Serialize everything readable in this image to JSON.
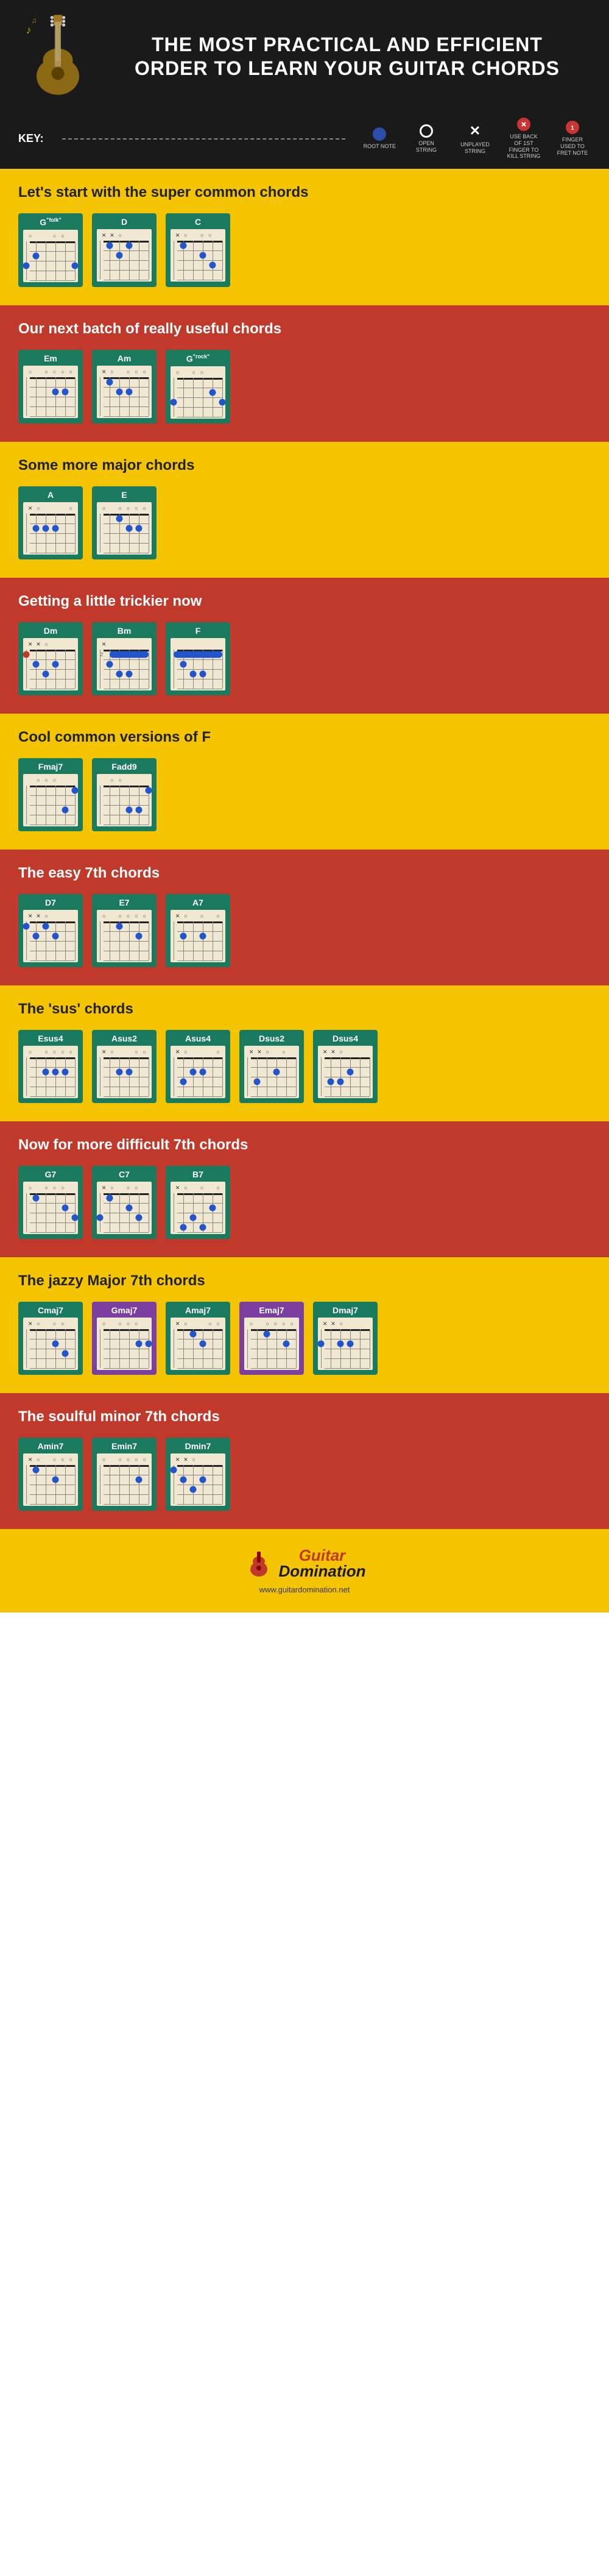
{
  "header": {
    "title": "THE MOST PRACTICAL AND EFFICIENT ORDER TO LEARN YOUR GUITAR CHORDS",
    "key_label": "KEY:"
  },
  "key_items": [
    {
      "label": "ROOT NOTE",
      "type": "root"
    },
    {
      "label": "OPEN STRING",
      "type": "open"
    },
    {
      "label": "UNPLAYED STRING",
      "type": "unplayed"
    },
    {
      "label": "USE BACK OF 1ST FINGER TO KILL STRING",
      "type": "back"
    },
    {
      "label": "FINGER USED TO FRET NOTE",
      "type": "fret"
    }
  ],
  "sections": [
    {
      "id": "super-common",
      "bg": "yellow",
      "title": "Let's start with the super common chords",
      "chords": [
        "G\"folk\"",
        "D",
        "C"
      ]
    },
    {
      "id": "useful",
      "bg": "red",
      "title": "Our next batch of really useful chords",
      "chords": [
        "Em",
        "Am",
        "G\"rock\""
      ]
    },
    {
      "id": "major",
      "bg": "yellow",
      "title": "Some more major chords",
      "chords": [
        "A",
        "E"
      ]
    },
    {
      "id": "tricky",
      "bg": "red",
      "title": "Getting a little trickier now",
      "chords": [
        "Dm",
        "Bm",
        "F"
      ]
    },
    {
      "id": "f-versions",
      "bg": "yellow",
      "title": "Cool common versions of F",
      "chords": [
        "Fmaj7",
        "Fadd9"
      ]
    },
    {
      "id": "easy-7th",
      "bg": "red",
      "title": "The easy 7th chords",
      "chords": [
        "D7",
        "E7",
        "A7"
      ]
    },
    {
      "id": "sus",
      "bg": "yellow",
      "title": "The 'sus' chords",
      "chords": [
        "Esus4",
        "Asus2",
        "Asus4",
        "Dsus2",
        "Dsus4"
      ]
    },
    {
      "id": "diff-7th",
      "bg": "red",
      "title": "Now for more difficult 7th chords",
      "chords": [
        "G7",
        "C7",
        "B7"
      ]
    },
    {
      "id": "jazzy-maj7",
      "bg": "yellow",
      "title": "The jazzy Major 7th chords",
      "chords": [
        "Cmaj7",
        "Gmaj7",
        "Amaj7",
        "Emaj7",
        "Dmaj7"
      ]
    },
    {
      "id": "soulful-min7",
      "bg": "red",
      "title": "The soulful minor 7th chords",
      "chords": [
        "Amin7",
        "Emin7",
        "Dmin7"
      ]
    }
  ],
  "footer": {
    "logo_line1": "Guitar",
    "logo_line2": "Domination",
    "url": "www.guitardomination.net"
  }
}
